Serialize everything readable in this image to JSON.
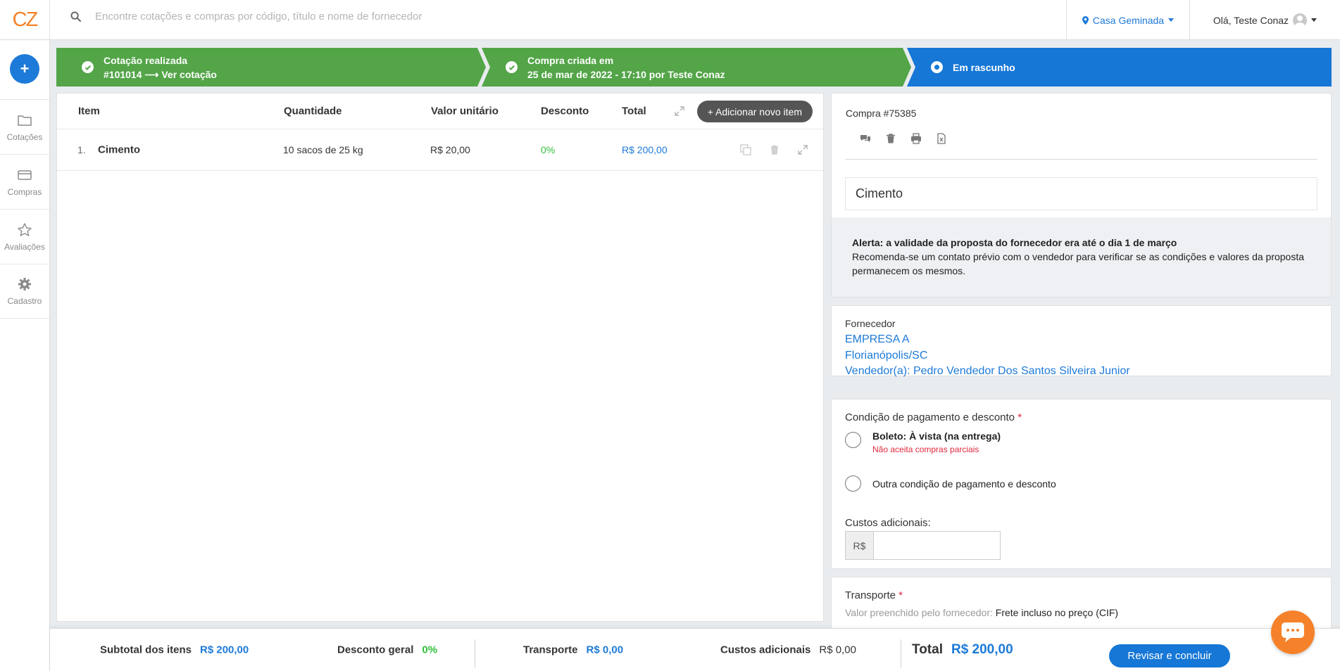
{
  "header": {
    "logo": "CZ",
    "search_placeholder": "Encontre cotações e compras por código, título e nome de fornecedor",
    "obra": "Casa Geminada",
    "greeting": "Olá, Teste Conaz"
  },
  "sidebar": {
    "add_label": "+",
    "items": [
      {
        "label": "Cotações"
      },
      {
        "label": "Compras"
      },
      {
        "label": "Avaliações"
      },
      {
        "label": "Cadastro"
      }
    ]
  },
  "steps": [
    {
      "line1": "Cotação realizada",
      "line2": "#101014 ⟶ Ver cotação",
      "state": "done"
    },
    {
      "line1": "Compra criada em",
      "line2": "25 de mar de 2022 - 17:10 por Teste Conaz",
      "state": "done"
    },
    {
      "line1": "Em rascunho",
      "state": "current"
    }
  ],
  "items_table": {
    "columns": [
      "Item",
      "Quantidade",
      "Valor unitário",
      "Desconto",
      "Total"
    ],
    "add_button": "+ Adicionar novo item",
    "rows": [
      {
        "index": "1.",
        "name": "Cimento",
        "quantity": "10 sacos de 25 kg",
        "unit_price": "R$ 20,00",
        "discount": "0%",
        "total": "R$ 200,00"
      }
    ]
  },
  "purchase": {
    "title": "Compra #75385",
    "item_name": "Cimento",
    "alert_title": "Alerta: a validade da proposta do fornecedor era até o dia 1 de março",
    "alert_text": "Recomenda-se um contato prévio com o vendedor para verificar se as condições e valores da proposta permanecem os mesmos."
  },
  "supplier": {
    "label": "Fornecedor",
    "name": "EMPRESA A",
    "city": "Florianópolis/SC",
    "seller": "Vendedor(a): Pedro Vendedor Dos Santos Silveira Junior"
  },
  "payment": {
    "title": "Condição de pagamento e desconto",
    "required_mark": "*",
    "option1": "Boleto: À vista (na entrega)",
    "option1_note": "Não aceita compras parciais",
    "option2": "Outra condição de pagamento e desconto",
    "extra_costs_label": "Custos adicionais:",
    "currency_prefix": "R$",
    "extra_costs_value": ""
  },
  "transport": {
    "title": "Transporte",
    "required_mark": "*",
    "filled_label": "Valor preenchido pelo fornecedor:",
    "filled_value": "Frete incluso no preço (CIF)"
  },
  "footer": {
    "subtotal_label": "Subtotal dos itens",
    "subtotal_value": "R$ 200,00",
    "discount_label": "Desconto geral",
    "discount_value": "0%",
    "transport_label": "Transporte",
    "transport_value": "R$ 0,00",
    "costs_label": "Custos adicionais",
    "costs_value": "R$ 0,00",
    "total_label": "Total",
    "total_value": "R$ 200,00",
    "submit_label": "Revisar e concluir"
  },
  "colors": {
    "primary": "#1677d6",
    "success": "#53a548",
    "brand": "#f5822a",
    "danger": "#e0293e"
  }
}
